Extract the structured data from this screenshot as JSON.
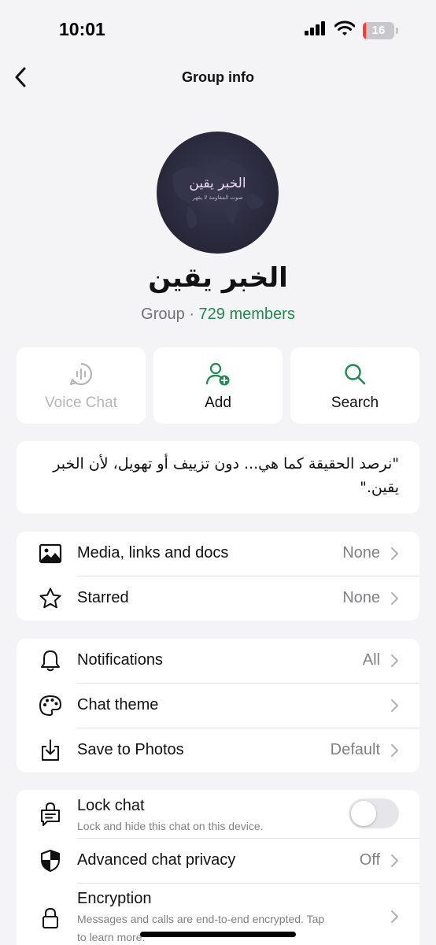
{
  "status_bar": {
    "time": "10:01",
    "battery": "16",
    "icons": [
      "cellular-signal-icon",
      "wifi-icon",
      "battery-icon"
    ]
  },
  "nav": {
    "title": "Group info",
    "back_icon": "chevron-left-icon"
  },
  "group": {
    "avatar_title": "الخبر يقين",
    "avatar_subtitle": "صوت المقاومة لا يقهر",
    "name": "الخبر يقين",
    "type": "Group",
    "separator": " · ",
    "members": "729 members"
  },
  "actions": [
    {
      "label": "Voice Chat",
      "icon": "voice-chat-icon",
      "enabled": false
    },
    {
      "label": "Add",
      "icon": "add-person-icon",
      "enabled": true
    },
    {
      "label": "Search",
      "icon": "search-icon",
      "enabled": true
    }
  ],
  "description": "\"نرصد الحقيقة كما هي... دون تزييف أو تهويل، لأن الخبر يقين.\"",
  "media_section": [
    {
      "label": "Media, links and docs",
      "value": "None",
      "icon": "image-icon"
    },
    {
      "label": "Starred",
      "value": "None",
      "icon": "star-icon"
    }
  ],
  "settings_section": [
    {
      "label": "Notifications",
      "value": "All",
      "icon": "bell-icon"
    },
    {
      "label": "Chat theme",
      "value": "",
      "icon": "palette-icon"
    },
    {
      "label": "Save to Photos",
      "value": "Default",
      "icon": "download-icon"
    }
  ],
  "privacy_section": {
    "lock_chat": {
      "label": "Lock chat",
      "subtitle": "Lock and hide this chat on this device.",
      "icon": "lock-chat-icon",
      "enabled": false
    },
    "advanced_privacy": {
      "label": "Advanced chat privacy",
      "value": "Off",
      "icon": "shield-icon"
    },
    "encryption": {
      "label": "Encryption",
      "subtitle_line1": "Messages and calls are end-to-end encrypted. Tap",
      "subtitle_line2": "to learn more.",
      "icon": "lock-icon"
    }
  },
  "colors": {
    "accent_green": "#1f8a4c",
    "background": "#f4f4f6",
    "muted_text": "#808085"
  }
}
